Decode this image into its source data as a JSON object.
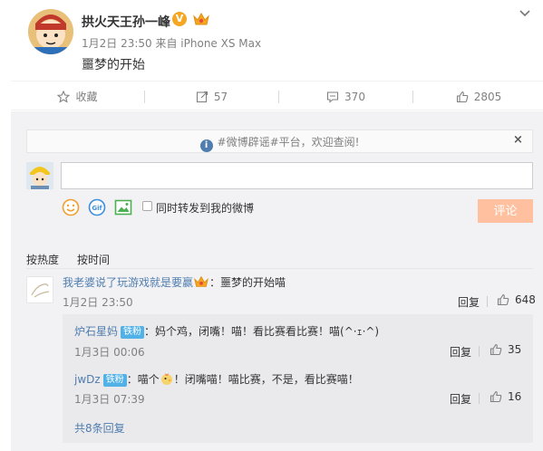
{
  "post": {
    "author": "拱火天王孙一峰",
    "verified_badge": "V",
    "meta": "1月2日 23:50 来自 iPhone XS Max",
    "text": "噩梦的开始"
  },
  "actions": {
    "favorite_label": "收藏",
    "repost_count": "57",
    "comment_count": "370",
    "like_count": "2805"
  },
  "notice": {
    "text": "#微博辟谣#平台，欢迎查阅!",
    "icon": "info-icon",
    "close": "×"
  },
  "composer": {
    "input_value": "",
    "tools": [
      "emoji-icon",
      "gif-icon",
      "image-icon"
    ],
    "sync_label": "同时转发到我的微博",
    "submit_label": "评论"
  },
  "sort": {
    "hot": "按热度",
    "time": "按时间"
  },
  "comments": [
    {
      "user": "我老婆说了玩游戏就是要赢",
      "text": "：噩梦的开始喵",
      "time": "1月2日 23:50",
      "reply_label": "回复",
      "likes": "648"
    }
  ],
  "replies": [
    {
      "user": "炉石星妈",
      "badge": "铁粉",
      "text": "：妈个鸡，闭嘴！喵！看比赛看比赛！喵(^·ｪ·^)",
      "time": "1月3日 00:06",
      "reply_label": "回复",
      "likes": "35"
    },
    {
      "user": "jwDz",
      "badge": "铁粉",
      "text_before": "：喵个",
      "text_after": "！闭嘴喵！喵比赛，不是，看比赛喵！",
      "time": "1月3日 07:39",
      "reply_label": "回复",
      "likes": "16"
    }
  ],
  "more_replies": "共8条回复",
  "colors": {
    "accent": "#eb7350",
    "link": "#507daf",
    "submit_disabled": "#ffc09f",
    "fan_badge": "#52b1e6"
  }
}
